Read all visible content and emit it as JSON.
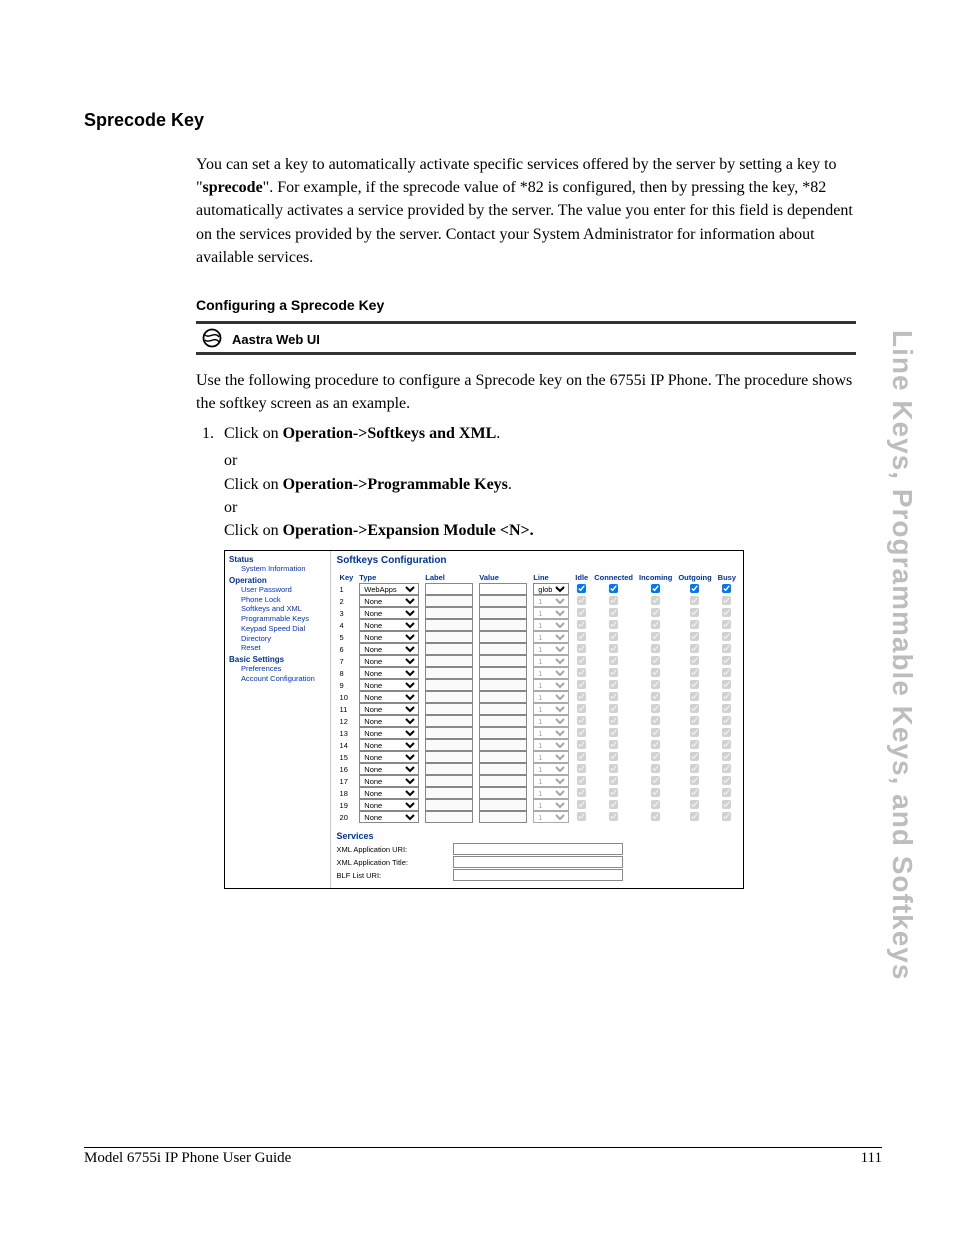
{
  "side_title": "Line Keys, Programmable Keys, and Softkeys",
  "section_title": "Sprecode Key",
  "paragraph_intro": "You can set a key to automatically activate specific services offered by the server by setting a key to \"sprecode\". For example, if the sprecode value of *82 is configured, then by pressing the key, *82 automatically activates a service provided by the server. The value you enter for this field is dependent on the services provided by the server. Contact your System Administrator for information about available services.",
  "subsection_title": "Configuring a Sprecode Key",
  "band_label": "Aastra Web UI",
  "procedure_intro": "Use the following procedure to configure a Sprecode key on the 6755i IP Phone. The procedure shows the softkey screen as an example.",
  "step1": {
    "prefix": "Click on ",
    "b1": "Operation->Softkeys and XML",
    "or": "or",
    "b2": "Operation->Programmable Keys",
    "b3": "Operation->Expansion Module <N>."
  },
  "webui": {
    "nav": {
      "groups": [
        {
          "label": "Status",
          "items": [
            "System Information"
          ]
        },
        {
          "label": "Operation",
          "items": [
            "User Password",
            "Phone Lock",
            "Softkeys and XML",
            "Programmable Keys",
            "Keypad Speed Dial",
            "Directory",
            "Reset"
          ]
        },
        {
          "label": "Basic Settings",
          "items": [
            "Preferences",
            "Account Configuration"
          ]
        }
      ]
    },
    "title": "Softkeys Configuration",
    "columns": [
      "Key",
      "Type",
      "Label",
      "Value",
      "Line",
      "Idle",
      "Connected",
      "Incoming",
      "Outgoing",
      "Busy"
    ],
    "rows": [
      {
        "key": 1,
        "type": "WebApps",
        "line": "global",
        "enabled": true
      },
      {
        "key": 2,
        "type": "None",
        "line": "1",
        "enabled": false
      },
      {
        "key": 3,
        "type": "None",
        "line": "1",
        "enabled": false
      },
      {
        "key": 4,
        "type": "None",
        "line": "1",
        "enabled": false
      },
      {
        "key": 5,
        "type": "None",
        "line": "1",
        "enabled": false
      },
      {
        "key": 6,
        "type": "None",
        "line": "1",
        "enabled": false
      },
      {
        "key": 7,
        "type": "None",
        "line": "1",
        "enabled": false
      },
      {
        "key": 8,
        "type": "None",
        "line": "1",
        "enabled": false
      },
      {
        "key": 9,
        "type": "None",
        "line": "1",
        "enabled": false
      },
      {
        "key": 10,
        "type": "None",
        "line": "1",
        "enabled": false
      },
      {
        "key": 11,
        "type": "None",
        "line": "1",
        "enabled": false
      },
      {
        "key": 12,
        "type": "None",
        "line": "1",
        "enabled": false
      },
      {
        "key": 13,
        "type": "None",
        "line": "1",
        "enabled": false
      },
      {
        "key": 14,
        "type": "None",
        "line": "1",
        "enabled": false
      },
      {
        "key": 15,
        "type": "None",
        "line": "1",
        "enabled": false
      },
      {
        "key": 16,
        "type": "None",
        "line": "1",
        "enabled": false
      },
      {
        "key": 17,
        "type": "None",
        "line": "1",
        "enabled": false
      },
      {
        "key": 18,
        "type": "None",
        "line": "1",
        "enabled": false
      },
      {
        "key": 19,
        "type": "None",
        "line": "1",
        "enabled": false
      },
      {
        "key": 20,
        "type": "None",
        "line": "1",
        "enabled": false
      }
    ],
    "services": {
      "title": "Services",
      "fields": [
        "XML Application URI:",
        "XML Application Title:",
        "BLF List URI:"
      ]
    }
  },
  "footer": {
    "left": "Model 6755i IP Phone User Guide",
    "right": "111"
  }
}
